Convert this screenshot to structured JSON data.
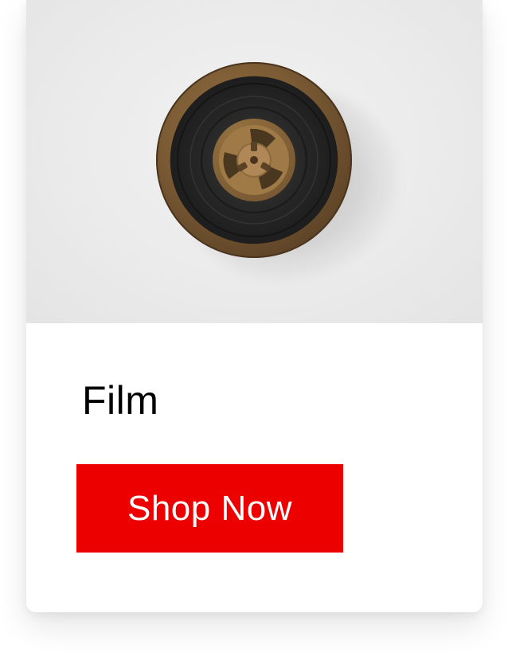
{
  "card": {
    "image": {
      "subject": "film-reel-icon"
    },
    "title": "Film",
    "cta_label": "Shop Now"
  },
  "colors": {
    "accent": "#ec0000",
    "title_text": "#000000",
    "button_text": "#ffffff",
    "media_background": "#ebebeb",
    "reel_brown": "#7a5a34"
  }
}
